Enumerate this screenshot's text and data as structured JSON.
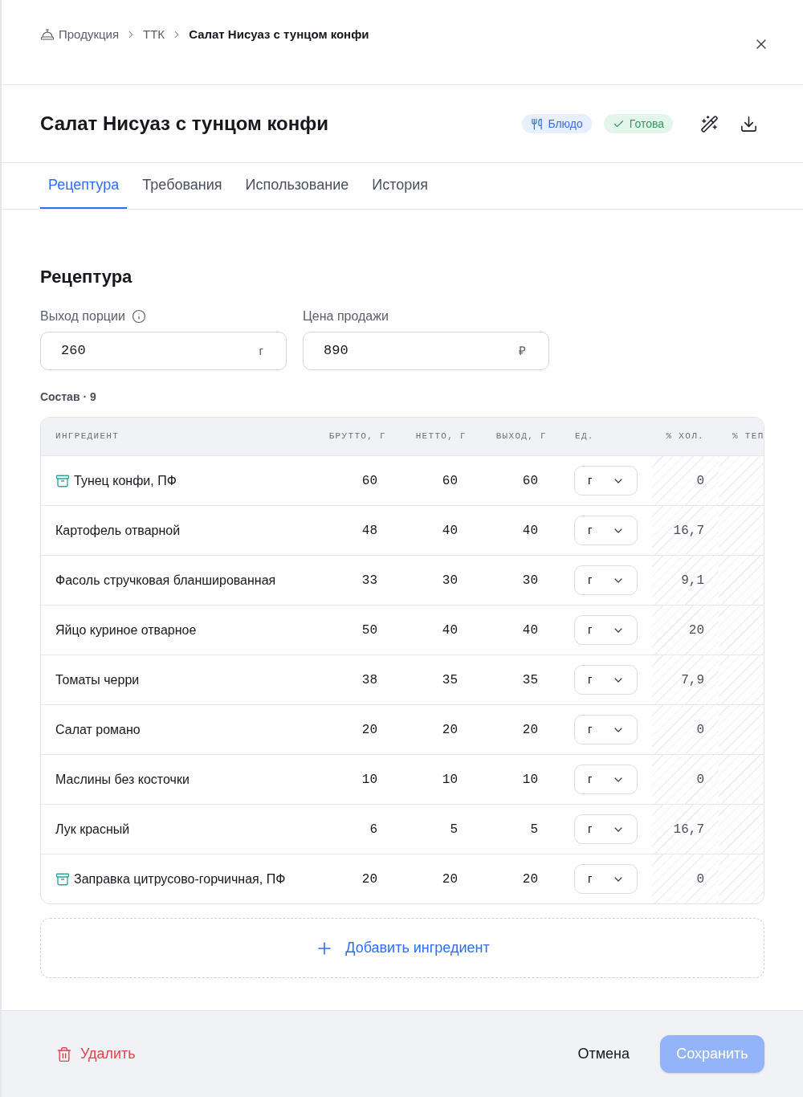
{
  "breadcrumb": [
    {
      "label": "Продукция",
      "current": false
    },
    {
      "label": "ТТК",
      "current": false
    },
    {
      "label": "Салат Нисуаз с тунцом конфи",
      "current": true
    }
  ],
  "title": "Салат Нисуаз с тунцом конфи",
  "badges": [
    {
      "label": "Блюдо",
      "kind": "type"
    },
    {
      "label": "Готова",
      "kind": "status"
    }
  ],
  "tabs": [
    {
      "label": "Рецептура",
      "selected": true
    },
    {
      "label": "Требования",
      "selected": false
    },
    {
      "label": "Использование",
      "selected": false
    },
    {
      "label": "История",
      "selected": false
    }
  ],
  "section_title": "Рецептура",
  "fields": [
    {
      "label": "Выход порции",
      "info": true,
      "value": "260",
      "suffix": "г"
    },
    {
      "label": "Цена продажи",
      "info": false,
      "value": "890",
      "suffix": "₽"
    }
  ],
  "composition_label": "Состав · 9",
  "table": {
    "columns": [
      "ИНГРЕДИЕНТ",
      "БРУТТО, Г",
      "НЕТТО, Г",
      "ВЫХОД, Г",
      "ЕД.",
      "% ХОЛ.",
      "% ТЕП"
    ],
    "rows": [
      {
        "name": "Тунец конфи, ПФ",
        "kind": "prep",
        "gross": "60",
        "net": "60",
        "yield": "60",
        "unit": "г",
        "cold_loss": "0"
      },
      {
        "name": "Картофель отварной",
        "kind": "raw",
        "gross": "48",
        "net": "40",
        "yield": "40",
        "unit": "г",
        "cold_loss": "16,7"
      },
      {
        "name": "Фасоль стручковая бланшированная",
        "kind": "raw",
        "gross": "33",
        "net": "30",
        "yield": "30",
        "unit": "г",
        "cold_loss": "9,1"
      },
      {
        "name": "Яйцо куриное отварное",
        "kind": "raw",
        "gross": "50",
        "net": "40",
        "yield": "40",
        "unit": "г",
        "cold_loss": "20"
      },
      {
        "name": "Томаты черри",
        "kind": "raw",
        "gross": "38",
        "net": "35",
        "yield": "35",
        "unit": "г",
        "cold_loss": "7,9"
      },
      {
        "name": "Салат романо",
        "kind": "raw",
        "gross": "20",
        "net": "20",
        "yield": "20",
        "unit": "г",
        "cold_loss": "0"
      },
      {
        "name": "Маслины без косточки",
        "kind": "raw",
        "gross": "10",
        "net": "10",
        "yield": "10",
        "unit": "г",
        "cold_loss": "0"
      },
      {
        "name": "Лук красный",
        "kind": "raw",
        "gross": "6",
        "net": "5",
        "yield": "5",
        "unit": "г",
        "cold_loss": "16,7"
      },
      {
        "name": "Заправка цитрусово-горчичная, ПФ",
        "kind": "prep",
        "gross": "20",
        "net": "20",
        "yield": "20",
        "unit": "г",
        "cold_loss": "0"
      }
    ]
  },
  "add_button": {
    "label": "Добавить ингредиент"
  },
  "footer": {
    "delete": {
      "label": "Удалить"
    },
    "cancel": {
      "label": "Отмена"
    },
    "save": {
      "label": "Сохранить",
      "disabled": true
    }
  }
}
